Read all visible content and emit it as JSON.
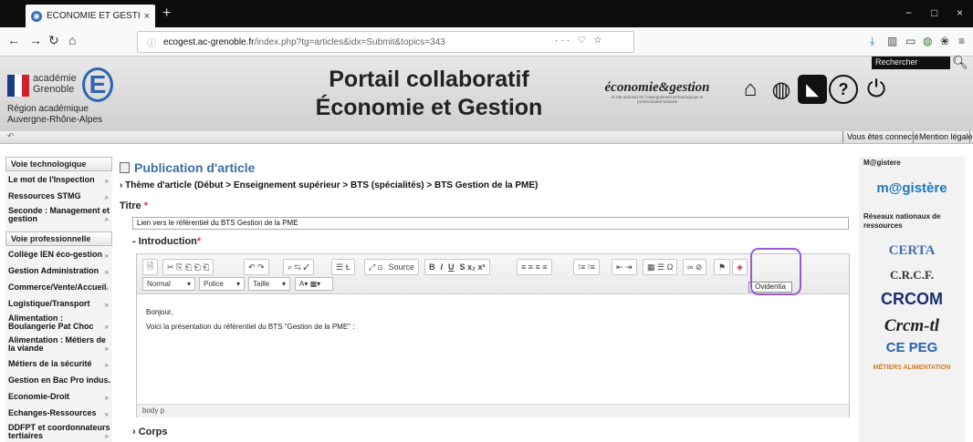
{
  "browser": {
    "tab_title": "ECONOMIE ET GESTION - GRE",
    "tab_close": "×",
    "new_tab": "+",
    "url_host": "ecogest.ac-grenoble.fr",
    "url_path": "/index.php?tg=articles&idx=Submit&topics=343",
    "url_prefix": "ecogest.",
    "minimize": "−",
    "maximize": "□",
    "close": "×"
  },
  "header": {
    "academie": "académie",
    "ville": "Grenoble",
    "region_line1": "Région académique",
    "region_line2": "Auvergne-Rhône-Alpes",
    "title_line1": "Portail collaboratif",
    "title_line2": "Économie et Gestion",
    "eco_logo": "économie&gestion",
    "eco_logo_sub": "le site national de l'enseignement technologique et professionnel tertiaire",
    "search_placeholder": "Rechercher"
  },
  "strip": {
    "connected": "Vous êtes connecté",
    "legal": "Mention légale"
  },
  "sidebar": {
    "section1": "Voie technologique",
    "items1": [
      {
        "label": "Le mot de l'Inspection"
      },
      {
        "label": "Ressources STMG"
      },
      {
        "label": "Seconde : Management et gestion"
      }
    ],
    "section2": "Voie professionnelle",
    "items2": [
      {
        "label": "Collège IEN éco-gestion"
      },
      {
        "label": "Gestion Administration"
      },
      {
        "label": "Commerce/Vente/Accueil"
      },
      {
        "label": "Logistique/Transport"
      },
      {
        "label": "Alimentation : Boulangerie Pat Choc"
      },
      {
        "label": "Alimentation : Métiers de la viande"
      },
      {
        "label": "Métiers de la sécurité"
      },
      {
        "label": "Gestion en Bac Pro indus."
      },
      {
        "label": "Economie-Droit"
      },
      {
        "label": "Echanges-Ressources"
      },
      {
        "label": "DDFPT et coordonnateurs tertiaires"
      }
    ]
  },
  "main": {
    "pub_title": "Publication d'article",
    "theme": "Thème d'article (Début > Enseignement supérieur > BTS (spécialités) > BTS Gestion de la PME)",
    "titre_label": "Titre",
    "titre_value": "Lien vers le référentiel du BTS Gestion de la PME",
    "intro_label": "Introduction",
    "corps_label": "Corps",
    "required_mark": "*"
  },
  "editor": {
    "source_label": "Source",
    "format_combo": "Normal",
    "font_combo": "Police",
    "size_combo": "Taille",
    "tooltip": "Ovidentia",
    "line1": "Bonjour,",
    "line2": "Voici la présentation du référentiel du BTS \"Gestion de la PME\" :",
    "footer_path": "body  p"
  },
  "rside": {
    "magistere_head": "M@gistere",
    "magistere_logo": "m@gistère",
    "reseaux_head": "Réseaux nationaux de ressources",
    "logos": [
      "CERTA",
      "C.R.C.F.",
      "CRCOM",
      "Crcm-tl",
      "CE PEG",
      "MÉTIERS ALIMENTATION"
    ]
  }
}
